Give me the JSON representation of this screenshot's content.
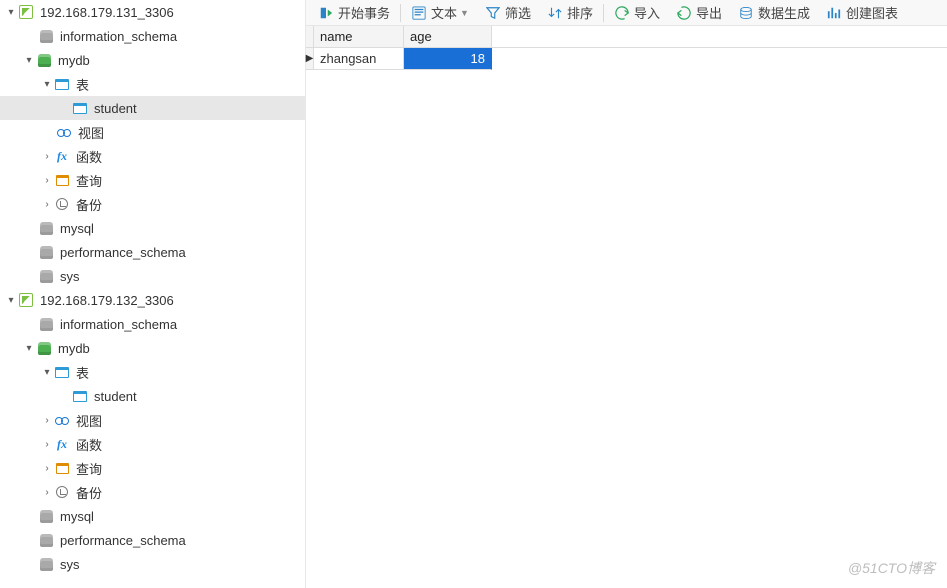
{
  "toolbar": {
    "begin_tx": "开始事务",
    "text": "文本",
    "filter": "筛选",
    "sort": "排序",
    "import": "导入",
    "export": "导出",
    "datagen": "数据生成",
    "chart": "创建图表"
  },
  "tree": {
    "srv1": {
      "host": "192.168.179.131_3306",
      "dbs": {
        "information_schema": "information_schema",
        "mydb": "mydb",
        "mysql": "mysql",
        "performance_schema": "performance_schema",
        "sys": "sys"
      },
      "mydb": {
        "tables_label": "表",
        "student": "student",
        "views": "视图",
        "functions": "函数",
        "queries": "查询",
        "backup": "备份"
      }
    },
    "srv2": {
      "host": "192.168.179.132_3306",
      "dbs": {
        "information_schema": "information_schema",
        "mydb": "mydb",
        "mysql": "mysql",
        "performance_schema": "performance_schema",
        "sys": "sys"
      },
      "mydb": {
        "tables_label": "表",
        "student": "student",
        "views": "视图",
        "functions": "函数",
        "queries": "查询",
        "backup": "备份"
      }
    }
  },
  "grid": {
    "cols": {
      "name": "name",
      "age": "age"
    },
    "rows": [
      {
        "name": "zhangsan",
        "age": "18"
      }
    ]
  },
  "watermark": "@51CTO博客"
}
